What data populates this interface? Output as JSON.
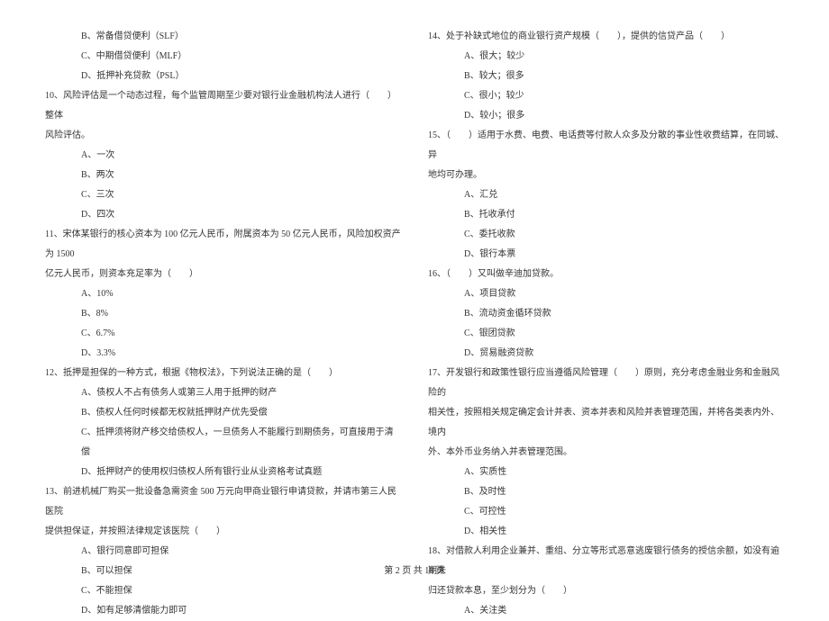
{
  "left_column": {
    "q9_options": [
      "B、常备借贷便利（SLF）",
      "C、中期借贷便利（MLF）",
      "D、抵押补充贷款（PSL）"
    ],
    "q10": {
      "text": "10、风险评估是一个动态过程，每个监管周期至少要对银行业金融机构法人进行（　　）整体",
      "continuation": "风险评估。",
      "options": [
        "A、一次",
        "B、两次",
        "C、三次",
        "D、四次"
      ]
    },
    "q11": {
      "text": "11、宋体某银行的核心资本为 100 亿元人民币，附属资本为 50 亿元人民币，风险加权资产为 1500",
      "continuation": "亿元人民币，则资本充足率为（　　）",
      "options": [
        "A、10%",
        "B、8%",
        "C、6.7%",
        "D、3.3%"
      ]
    },
    "q12": {
      "text": "12、抵押是担保的一种方式，根据《物权法》，下列说法正确的是（　　）",
      "options": [
        "A、债权人不占有债务人或第三人用于抵押的财产",
        "B、债权人任何时候都无权就抵押财产优先受偿",
        "C、抵押须将财产移交给债权人，一旦债务人不能履行到期债务，可直接用于清偿",
        "D、抵押财产的使用权归债权人所有银行业从业资格考试真题"
      ]
    },
    "q13": {
      "text": "13、前进机械厂购买一批设备急需资金 500 万元向甲商业银行申请贷款，并请市第三人民医院",
      "continuation": "提供担保证，并按照法律规定该医院（　　）",
      "options": [
        "A、银行同意即可担保",
        "B、可以担保",
        "C、不能担保",
        "D、如有足够清偿能力即可"
      ]
    }
  },
  "right_column": {
    "q14": {
      "text": "14、处于补缺式地位的商业银行资产规模（　　），提供的信贷产品（　　）",
      "options": [
        "A、很大；较少",
        "B、较大；很多",
        "C、很小；较少",
        "D、较小；很多"
      ]
    },
    "q15": {
      "text": "15、（　　）适用于水费、电费、电话费等付款人众多及分散的事业性收费结算，在同城、异",
      "continuation": "地均可办理。",
      "options": [
        "A、汇兑",
        "B、托收承付",
        "C、委托收款",
        "D、银行本票"
      ]
    },
    "q16": {
      "text": "16、（　　）又叫做辛迪加贷款。",
      "options": [
        "A、项目贷款",
        "B、流动资金循环贷款",
        "C、银团贷款",
        "D、贸易融资贷款"
      ]
    },
    "q17": {
      "text": "17、开发银行和政策性银行应当遵循风险管理（　　）原则，充分考虑金融业务和金融风险的",
      "continuation1": "相关性，按照相关规定确定会计并表、资本并表和风险并表管理范围，并将各类表内外、境内",
      "continuation2": "外、本外币业务纳入并表管理范围。",
      "options": [
        "A、实质性",
        "B、及时性",
        "C、可控性",
        "D、相关性"
      ]
    },
    "q18": {
      "text": "18、对借款人利用企业兼并、重组、分立等形式恶意逃废银行债务的授信余额，如没有逾期未",
      "continuation": "归还贷款本息，至少划分为（　　）",
      "options": [
        "A、关注类"
      ]
    }
  },
  "footer": "第 2 页 共 18 页"
}
